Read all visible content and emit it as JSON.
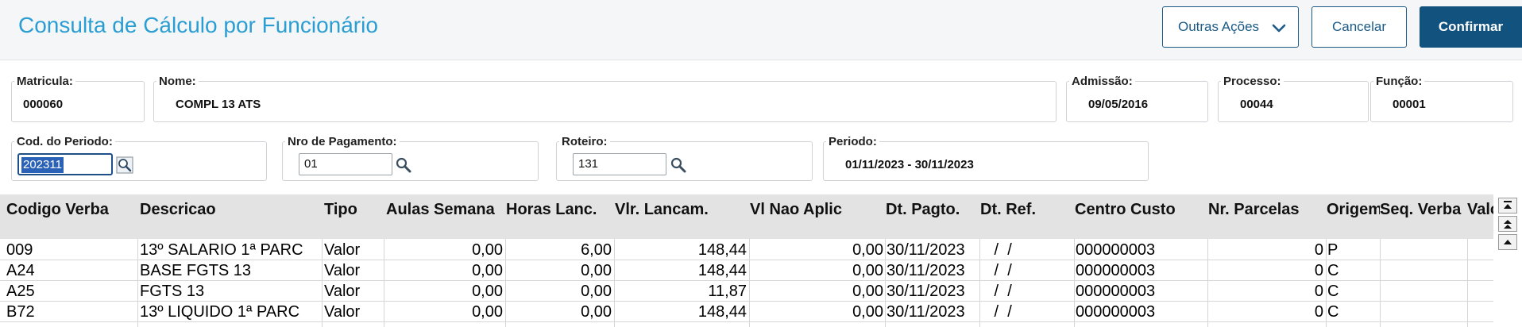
{
  "header": {
    "title": "Consulta de Cálculo por Funcionário",
    "other_actions": "Outras Ações",
    "cancel": "Cancelar",
    "confirm": "Confirmar"
  },
  "fields": {
    "matricula": {
      "label": "Matricula:",
      "value": "000060"
    },
    "nome": {
      "label": "Nome:",
      "value": "COMPL 13 ATS"
    },
    "admissao": {
      "label": "Admissão:",
      "value": "09/05/2016"
    },
    "processo": {
      "label": "Processo:",
      "value": "00044"
    },
    "funcao": {
      "label": "Função:",
      "value": "00001"
    },
    "cod_periodo": {
      "label": "Cod. do Periodo:",
      "value": "202311"
    },
    "nro_pagamento": {
      "label": "Nro de Pagamento:",
      "value": "01"
    },
    "roteiro": {
      "label": "Roteiro:",
      "value": "131"
    },
    "periodo": {
      "label": "Periodo:",
      "value": "01/11/2023 - 30/11/2023"
    }
  },
  "grid": {
    "columns": [
      "Codigo Verba",
      "Descricao",
      "Tipo",
      "Aulas Semana",
      "Horas Lanc.",
      "Vlr. Lancam.",
      "Vl Nao Aplic",
      "Dt. Pagto.",
      "Dt. Ref.",
      "Centro Custo",
      "Nr. Parcelas",
      "Origem",
      "Seq. Verba",
      "Valor"
    ],
    "rows": [
      [
        "009",
        "13º SALARIO 1ª PARC",
        "Valor",
        "0,00",
        "6,00",
        "148,44",
        "0,00",
        "30/11/2023",
        " /  /",
        "000000003",
        "0",
        "P",
        ""
      ],
      [
        "A24",
        "BASE FGTS 13",
        "Valor",
        "0,00",
        "0,00",
        "148,44",
        "0,00",
        "30/11/2023",
        " /  /",
        "000000003",
        "0",
        "C",
        ""
      ],
      [
        "A25",
        "FGTS 13",
        "Valor",
        "0,00",
        "0,00",
        "11,87",
        "0,00",
        "30/11/2023",
        " /  /",
        "000000003",
        "0",
        "C",
        ""
      ],
      [
        "B72",
        "13º LIQUIDO 1ª PARC",
        "Valor",
        "0,00",
        "0,00",
        "148,44",
        "0,00",
        "30/11/2023",
        " /  /",
        "000000003",
        "0",
        "C",
        ""
      ]
    ]
  },
  "icons": {
    "chevron": "chevron-down-icon",
    "search": "search-icon",
    "lookup": "lookup-icon",
    "scroll_top": "scroll-top-icon",
    "page_up": "page-up-icon",
    "scroll_up": "scroll-up-icon"
  },
  "colors": {
    "title": "#2a9ed3",
    "primary": "#11527f",
    "selection": "#2a62b8",
    "grid_header": "#e3e3e3"
  }
}
